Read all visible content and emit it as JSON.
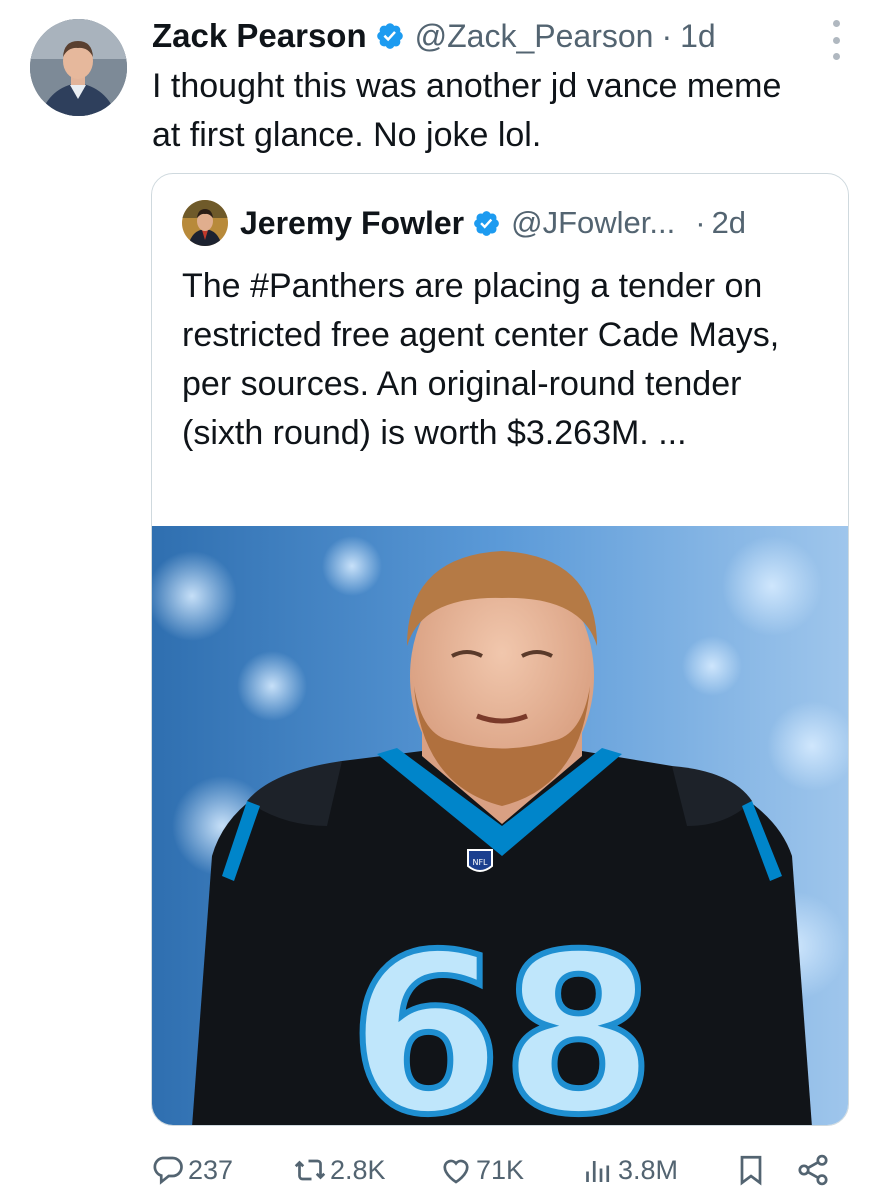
{
  "tweet": {
    "author_name": "Zack Pearson",
    "handle": "@Zack_Pearson",
    "separator": "·",
    "time": "1d",
    "text": "I thought this was another jd vance meme at first glance. No joke lol."
  },
  "quoted_tweet": {
    "author_name": "Jeremy Fowler",
    "handle": "@JFowler...",
    "separator": "·",
    "time": "2d",
    "text": "The #Panthers are placing a tender on restricted free agent center Cade Mays, per sources. An original-round tender (sixth round) is worth $3.263M. ...",
    "image": {
      "jersey_number": "68",
      "jersey_badge": "NFL"
    }
  },
  "actions": {
    "replies": "237",
    "reposts": "2.8K",
    "likes": "71K",
    "views": "3.8M"
  },
  "icons": [
    "verified-badge-icon",
    "more-options-icon",
    "reply-icon",
    "repost-icon",
    "like-icon",
    "views-icon",
    "bookmark-icon",
    "share-icon"
  ],
  "colors": {
    "verified_blue": "#1d9bf0",
    "secondary_text": "#536471",
    "panthers_blue": "#0085ca",
    "jersey_black": "#111418",
    "number_fill": "#bfe6fb"
  }
}
